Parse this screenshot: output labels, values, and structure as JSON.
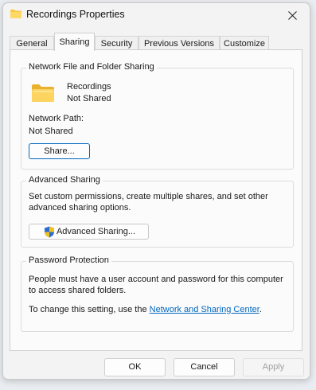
{
  "window": {
    "title": "Recordings Properties"
  },
  "tabs": [
    {
      "label": "General",
      "active": false
    },
    {
      "label": "Sharing",
      "active": true
    },
    {
      "label": "Security",
      "active": false
    },
    {
      "label": "Previous Versions",
      "active": false
    },
    {
      "label": "Customize",
      "active": false
    }
  ],
  "network_sharing": {
    "group_title": "Network File and Folder Sharing",
    "folder_name": "Recordings",
    "share_status": "Not Shared",
    "path_label": "Network Path:",
    "path_value": "Not Shared",
    "share_button": "Share..."
  },
  "advanced_sharing": {
    "group_title": "Advanced Sharing",
    "description": "Set custom permissions, create multiple shares, and set other advanced sharing options.",
    "button": "Advanced Sharing..."
  },
  "password_protection": {
    "group_title": "Password Protection",
    "description": "People must have a user account and password for this computer to access shared folders.",
    "change_prefix": "To change this setting, use the ",
    "link_text": "Network and Sharing Center",
    "change_suffix": "."
  },
  "footer": {
    "ok": "OK",
    "cancel": "Cancel",
    "apply": "Apply"
  },
  "icons": {
    "window_icon": "folder-icon",
    "close": "close-icon",
    "folder": "folder-icon",
    "shield": "uac-shield-icon"
  },
  "colors": {
    "link": "#0067c0",
    "focus": "#0067c0",
    "folder": "#f7c848"
  }
}
